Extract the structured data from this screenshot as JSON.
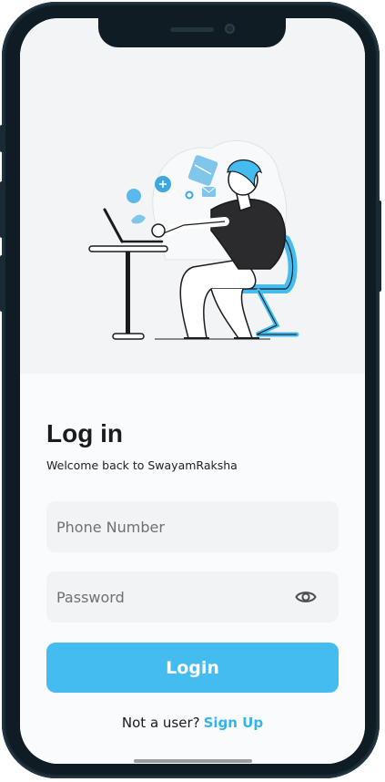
{
  "screen": {
    "title": "Log in",
    "subtitle": "Welcome back to SwayamRaksha"
  },
  "form": {
    "phone": {
      "placeholder": "Phone Number",
      "value": ""
    },
    "password": {
      "placeholder": "Password",
      "value": "",
      "toggle_icon": "eye-icon"
    },
    "login_label": "Login"
  },
  "footer": {
    "prompt": "Not a user?",
    "signup_label": "Sign Up"
  },
  "colors": {
    "accent": "#45bcf0",
    "link": "#34b4ea",
    "background": "#f6f7f9",
    "field": "#f2f3f5",
    "text": "#1b1b1f"
  },
  "icons": [
    "eye-icon",
    "person-at-desk-illustration"
  ]
}
